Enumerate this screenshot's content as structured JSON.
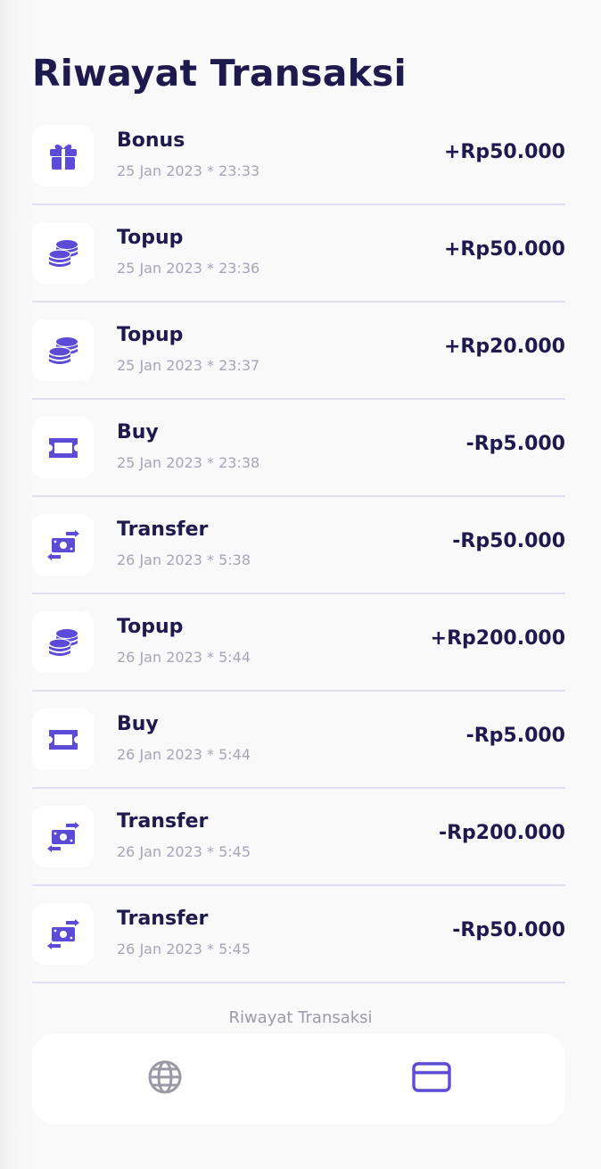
{
  "page": {
    "title": "Riwayat Transaksi"
  },
  "colors": {
    "accent": "#5b4bd6",
    "text_primary": "#1f1a4d",
    "text_muted": "#a7a5b6",
    "divider": "#e0dff0",
    "nav_inactive": "#9a99a6"
  },
  "transactions": [
    {
      "name": "Bonus",
      "date": "25 Jan 2023 * 23:33",
      "amount": "+Rp50.000",
      "icon": "gift-icon"
    },
    {
      "name": "Topup",
      "date": "25 Jan 2023 * 23:36",
      "amount": "+Rp50.000",
      "icon": "coins-icon"
    },
    {
      "name": "Topup",
      "date": "25 Jan 2023 * 23:37",
      "amount": "+Rp20.000",
      "icon": "coins-icon"
    },
    {
      "name": "Buy",
      "date": "25 Jan 2023 * 23:38",
      "amount": "-Rp5.000",
      "icon": "ticket-icon"
    },
    {
      "name": "Transfer",
      "date": "26 Jan 2023 * 5:38",
      "amount": "-Rp50.000",
      "icon": "money-transfer-icon"
    },
    {
      "name": "Topup",
      "date": "26 Jan 2023 * 5:44",
      "amount": "+Rp200.000",
      "icon": "coins-icon"
    },
    {
      "name": "Buy",
      "date": "26 Jan 2023 * 5:44",
      "amount": "-Rp5.000",
      "icon": "ticket-icon"
    },
    {
      "name": "Transfer",
      "date": "26 Jan 2023 * 5:45",
      "amount": "-Rp200.000",
      "icon": "money-transfer-icon"
    },
    {
      "name": "Transfer",
      "date": "26 Jan 2023 * 5:45",
      "amount": "-Rp50.000",
      "icon": "money-transfer-icon"
    }
  ],
  "bottom_nav": {
    "active_label": "Riwayat Transaksi",
    "items": [
      {
        "icon": "globe-icon",
        "active": false
      },
      {
        "icon": "credit-card-icon",
        "active": true
      }
    ]
  }
}
